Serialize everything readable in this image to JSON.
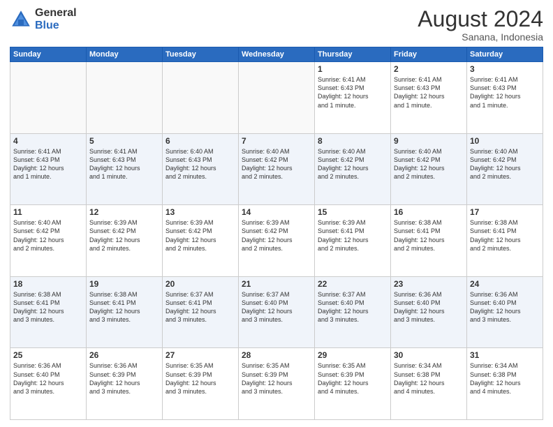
{
  "header": {
    "logo_general": "General",
    "logo_blue": "Blue",
    "month_year": "August 2024",
    "location": "Sanana, Indonesia"
  },
  "weekdays": [
    "Sunday",
    "Monday",
    "Tuesday",
    "Wednesday",
    "Thursday",
    "Friday",
    "Saturday"
  ],
  "weeks": [
    [
      {
        "day": "",
        "info": ""
      },
      {
        "day": "",
        "info": ""
      },
      {
        "day": "",
        "info": ""
      },
      {
        "day": "",
        "info": ""
      },
      {
        "day": "1",
        "info": "Sunrise: 6:41 AM\nSunset: 6:43 PM\nDaylight: 12 hours\nand 1 minute."
      },
      {
        "day": "2",
        "info": "Sunrise: 6:41 AM\nSunset: 6:43 PM\nDaylight: 12 hours\nand 1 minute."
      },
      {
        "day": "3",
        "info": "Sunrise: 6:41 AM\nSunset: 6:43 PM\nDaylight: 12 hours\nand 1 minute."
      }
    ],
    [
      {
        "day": "4",
        "info": "Sunrise: 6:41 AM\nSunset: 6:43 PM\nDaylight: 12 hours\nand 1 minute."
      },
      {
        "day": "5",
        "info": "Sunrise: 6:41 AM\nSunset: 6:43 PM\nDaylight: 12 hours\nand 1 minute."
      },
      {
        "day": "6",
        "info": "Sunrise: 6:40 AM\nSunset: 6:43 PM\nDaylight: 12 hours\nand 2 minutes."
      },
      {
        "day": "7",
        "info": "Sunrise: 6:40 AM\nSunset: 6:42 PM\nDaylight: 12 hours\nand 2 minutes."
      },
      {
        "day": "8",
        "info": "Sunrise: 6:40 AM\nSunset: 6:42 PM\nDaylight: 12 hours\nand 2 minutes."
      },
      {
        "day": "9",
        "info": "Sunrise: 6:40 AM\nSunset: 6:42 PM\nDaylight: 12 hours\nand 2 minutes."
      },
      {
        "day": "10",
        "info": "Sunrise: 6:40 AM\nSunset: 6:42 PM\nDaylight: 12 hours\nand 2 minutes."
      }
    ],
    [
      {
        "day": "11",
        "info": "Sunrise: 6:40 AM\nSunset: 6:42 PM\nDaylight: 12 hours\nand 2 minutes."
      },
      {
        "day": "12",
        "info": "Sunrise: 6:39 AM\nSunset: 6:42 PM\nDaylight: 12 hours\nand 2 minutes."
      },
      {
        "day": "13",
        "info": "Sunrise: 6:39 AM\nSunset: 6:42 PM\nDaylight: 12 hours\nand 2 minutes."
      },
      {
        "day": "14",
        "info": "Sunrise: 6:39 AM\nSunset: 6:42 PM\nDaylight: 12 hours\nand 2 minutes."
      },
      {
        "day": "15",
        "info": "Sunrise: 6:39 AM\nSunset: 6:41 PM\nDaylight: 12 hours\nand 2 minutes."
      },
      {
        "day": "16",
        "info": "Sunrise: 6:38 AM\nSunset: 6:41 PM\nDaylight: 12 hours\nand 2 minutes."
      },
      {
        "day": "17",
        "info": "Sunrise: 6:38 AM\nSunset: 6:41 PM\nDaylight: 12 hours\nand 2 minutes."
      }
    ],
    [
      {
        "day": "18",
        "info": "Sunrise: 6:38 AM\nSunset: 6:41 PM\nDaylight: 12 hours\nand 3 minutes."
      },
      {
        "day": "19",
        "info": "Sunrise: 6:38 AM\nSunset: 6:41 PM\nDaylight: 12 hours\nand 3 minutes."
      },
      {
        "day": "20",
        "info": "Sunrise: 6:37 AM\nSunset: 6:41 PM\nDaylight: 12 hours\nand 3 minutes."
      },
      {
        "day": "21",
        "info": "Sunrise: 6:37 AM\nSunset: 6:40 PM\nDaylight: 12 hours\nand 3 minutes."
      },
      {
        "day": "22",
        "info": "Sunrise: 6:37 AM\nSunset: 6:40 PM\nDaylight: 12 hours\nand 3 minutes."
      },
      {
        "day": "23",
        "info": "Sunrise: 6:36 AM\nSunset: 6:40 PM\nDaylight: 12 hours\nand 3 minutes."
      },
      {
        "day": "24",
        "info": "Sunrise: 6:36 AM\nSunset: 6:40 PM\nDaylight: 12 hours\nand 3 minutes."
      }
    ],
    [
      {
        "day": "25",
        "info": "Sunrise: 6:36 AM\nSunset: 6:40 PM\nDaylight: 12 hours\nand 3 minutes."
      },
      {
        "day": "26",
        "info": "Sunrise: 6:36 AM\nSunset: 6:39 PM\nDaylight: 12 hours\nand 3 minutes."
      },
      {
        "day": "27",
        "info": "Sunrise: 6:35 AM\nSunset: 6:39 PM\nDaylight: 12 hours\nand 3 minutes."
      },
      {
        "day": "28",
        "info": "Sunrise: 6:35 AM\nSunset: 6:39 PM\nDaylight: 12 hours\nand 3 minutes."
      },
      {
        "day": "29",
        "info": "Sunrise: 6:35 AM\nSunset: 6:39 PM\nDaylight: 12 hours\nand 4 minutes."
      },
      {
        "day": "30",
        "info": "Sunrise: 6:34 AM\nSunset: 6:38 PM\nDaylight: 12 hours\nand 4 minutes."
      },
      {
        "day": "31",
        "info": "Sunrise: 6:34 AM\nSunset: 6:38 PM\nDaylight: 12 hours\nand 4 minutes."
      }
    ]
  ]
}
